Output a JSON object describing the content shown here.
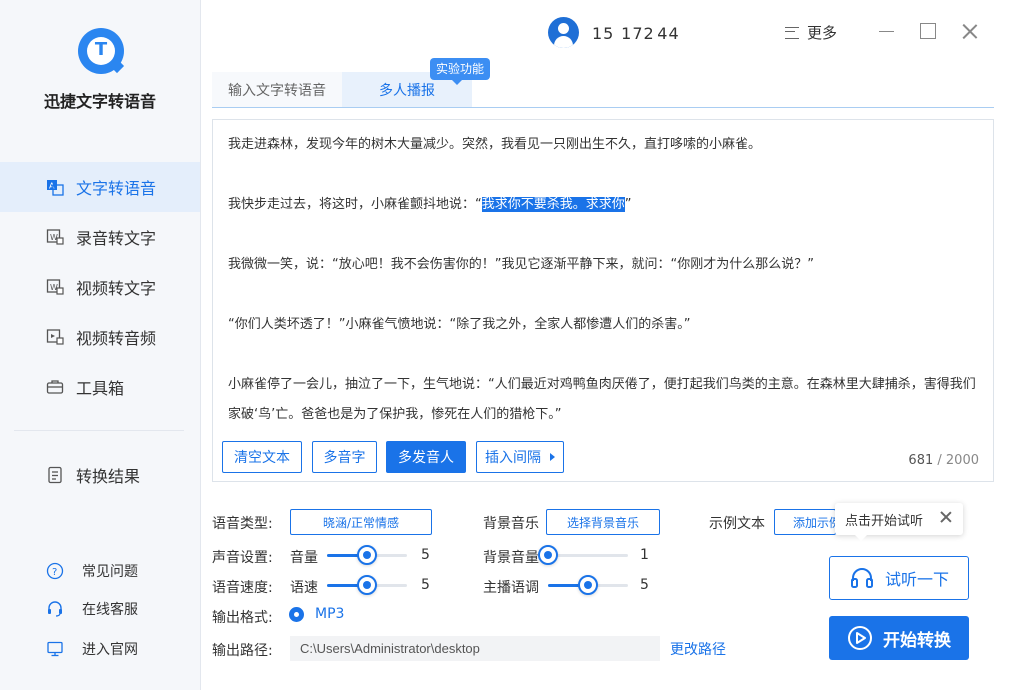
{
  "app": {
    "title": "迅捷文字转语音"
  },
  "sidebar": {
    "items": [
      {
        "label": "文字转语音",
        "icon": "text-to-speech-icon"
      },
      {
        "label": "录音转文字",
        "icon": "audio-to-text-icon"
      },
      {
        "label": "视频转文字",
        "icon": "video-to-text-icon"
      },
      {
        "label": "视频转音频",
        "icon": "video-to-audio-icon"
      },
      {
        "label": "工具箱",
        "icon": "toolbox-icon"
      },
      {
        "label": "转换结果",
        "icon": "result-icon"
      }
    ],
    "footer": [
      {
        "label": "常见问题",
        "icon": "question-icon"
      },
      {
        "label": "在线客服",
        "icon": "headset-icon"
      },
      {
        "label": "进入官网",
        "icon": "monitor-icon"
      }
    ]
  },
  "header": {
    "user_id": "15  172 44",
    "more_label": "更多"
  },
  "tabs": [
    {
      "label": "输入文字转语音"
    },
    {
      "label": "多人播报"
    }
  ],
  "experimental_badge": "实验功能",
  "editor": {
    "paragraphs": [
      "我走进森林，发现今年的树木大量减少。突然，我看见一只刚出生不久，直打哆嗦的小麻雀。",
      "我快步走过去，将这时，小麻雀颤抖地说：“",
      "我求你不要杀我。求求你",
      "”",
      "我微微一笑，说：“放心吧！我不会伤害你的！”我见它逐渐平静下来，就问：“你刚才为什么那么说？”",
      "“你们人类坏透了！”小麻雀气愤地说：“除了我之外，全家人都惨遭人们的杀害。”",
      "小麻雀停了一会儿，抽泣了一下，生气地说：“人们最近对鸡鸭鱼肉厌倦了，便打起我们鸟类的主意。在森林里大肆捕杀，害得我们家破‘鸟’亡。爸爸也是为了保护我，惨死在人们的猎枪下。”"
    ],
    "buttons": {
      "clear": "清空文本",
      "polyphone": "多音字",
      "multi_speaker": "多发音人",
      "insert_pause": "插入间隔"
    },
    "char_count": "681",
    "char_limit": "/ 2000"
  },
  "settings": {
    "voice_type_label": "语音类型:",
    "voice_type_value": "晓涵/正常情感",
    "bgm_label": "背景音乐",
    "bgm_button": "选择背景音乐",
    "sample_label": "示例文本",
    "sample_button": "添加示例",
    "sound_label": "声音设置:",
    "volume_label": "音量",
    "volume_value": "5",
    "volume_fraction": 0.5,
    "bg_volume_label": "背景音量",
    "bg_volume_value": "1",
    "bg_volume_fraction": 0.0,
    "speed_label": "语音速度:",
    "rate_label": "语速",
    "rate_value": "5",
    "rate_fraction": 0.5,
    "pitch_label": "主播语调",
    "pitch_value": "5",
    "pitch_fraction": 0.5,
    "format_label": "输出格式:",
    "format_value": "MP3",
    "path_label": "输出路径:",
    "path_value": "C:\\Users\\Administrator\\desktop",
    "change_path": "更改路径"
  },
  "tooltip": {
    "text": "点击开始试听"
  },
  "actions": {
    "listen": "试听一下",
    "start": "开始转换"
  },
  "colors": {
    "accent": "#1a73e8",
    "sidebar_bg": "#f5f7fa",
    "active_bg": "#e4eefb"
  }
}
